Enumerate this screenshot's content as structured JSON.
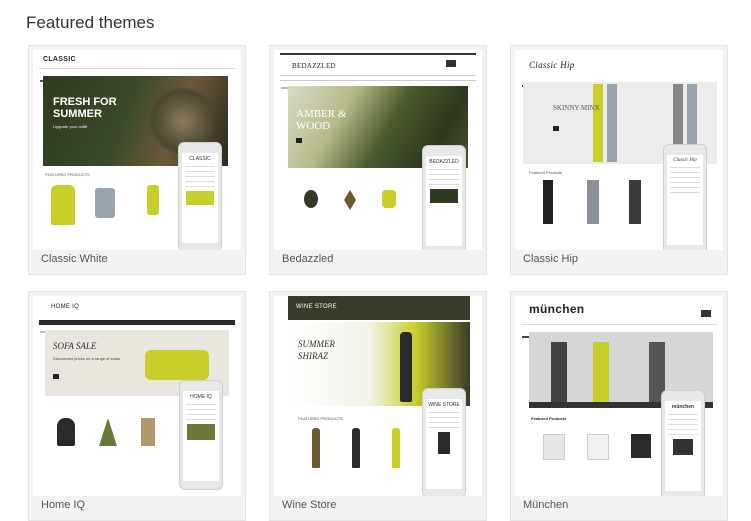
{
  "section_title": "Featured themes",
  "colors": {
    "accent_yellow": "#c9cf2a",
    "dark_green": "#2f3a22",
    "nav_dark": "#2a2a2a"
  },
  "themes": [
    {
      "label": "Classic White",
      "preview": {
        "logo": "CLASSIC",
        "hero_title": "FRESH FOR SUMMER",
        "hero_sub": "Upgrade your outfit",
        "section": "FEATURED PRODUCTS",
        "mobile_logo": "CLASSIC"
      }
    },
    {
      "label": "Bedazzled",
      "preview": {
        "logo": "BEDAZZLED",
        "hero_title": "AMBER & WOOD",
        "hero_sub": "",
        "section": "",
        "mobile_logo": "BEDAZZLED"
      }
    },
    {
      "label": "Classic Hip",
      "preview": {
        "logo": "Classic Hip",
        "hero_title": "SKINNY MINX",
        "hero_sub": "",
        "section": "Featured Products",
        "mobile_logo": "Classic Hip"
      }
    },
    {
      "label": "Home IQ",
      "preview": {
        "logo": "HOME IQ",
        "hero_title": "SOFA SALE",
        "hero_sub": "Discounted prices on a range of sofas",
        "section": "",
        "mobile_logo": "HOME IQ"
      }
    },
    {
      "label": "Wine Store",
      "preview": {
        "logo": "WINE STORE",
        "hero_title": "SUMMER SHIRAZ",
        "hero_sub": "",
        "section": "FEATURED PRODUCTS",
        "mobile_logo": "WINE STORE"
      }
    },
    {
      "label": "München",
      "preview": {
        "logo": "münchen",
        "hero_title": "",
        "hero_sub": "",
        "section": "Featured Products",
        "mobile_logo": "münchen"
      }
    }
  ]
}
